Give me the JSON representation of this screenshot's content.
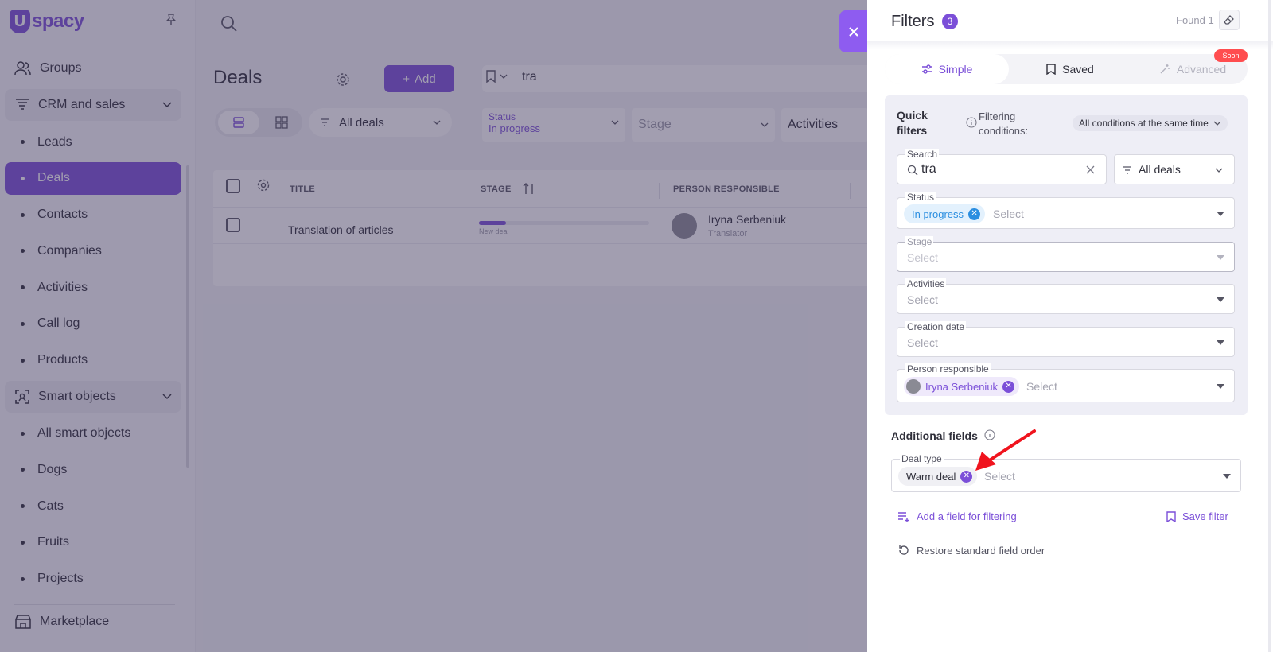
{
  "sidebar": {
    "logo_text": "spacy",
    "logo_letter": "U",
    "groups": {
      "groups_label": "Groups",
      "crm_label": "CRM and sales",
      "smart_label": "Smart objects"
    },
    "crm_items": [
      "Leads",
      "Deals",
      "Contacts",
      "Companies",
      "Activities",
      "Call log",
      "Products"
    ],
    "smart_items": [
      "All smart objects",
      "Dogs",
      "Cats",
      "Fruits",
      "Projects"
    ],
    "marketplace_label": "Marketplace"
  },
  "main": {
    "page_title": "Deals",
    "add_label": "Add",
    "search_value": "tra",
    "all_deals_label": "All deals",
    "status_label": "Status",
    "status_value": "In progress",
    "stage_placeholder": "Stage",
    "activities_label": "Activities",
    "table": {
      "headers": [
        "TITLE",
        "STAGE",
        "PERSON RESPONSIBLE"
      ],
      "rows": [
        {
          "title": "Translation of articles",
          "stage": "New deal",
          "person": "Iryna Serbeniuk",
          "role": "Translator",
          "stage_progress": 0.16
        }
      ]
    }
  },
  "filters": {
    "title": "Filters",
    "count": "3",
    "found": "Found 1",
    "tabs": {
      "simple": "Simple",
      "saved": "Saved",
      "advanced": "Advanced",
      "soon": "Soon"
    },
    "quick": {
      "title": "Quick filters",
      "conditions_label": "Filtering conditions:",
      "conditions_value": "All conditions at the same time",
      "search_label": "Search",
      "search_value": "tra",
      "all_deals": "All deals",
      "status_label": "Status",
      "status_chip": "In progress",
      "stage_label": "Stage",
      "activities_label": "Activities",
      "creation_label": "Creation date",
      "person_label": "Person responsible",
      "person_chip": "Iryna Serbeniuk",
      "placeholder": "Select"
    },
    "additional": {
      "title": "Additional fields",
      "deal_type_label": "Deal type",
      "deal_type_chip": "Warm deal",
      "placeholder": "Select"
    },
    "add_field": "Add a field for filtering",
    "save_filter": "Save filter",
    "restore": "Restore standard field order"
  },
  "colors": {
    "accent": "#7b4fd8",
    "status_chip_bg": "#e3f1fd",
    "status_chip_text": "#2b8ee0",
    "soon_badge": "#ff4d4f",
    "arrow": "#f0141e"
  }
}
